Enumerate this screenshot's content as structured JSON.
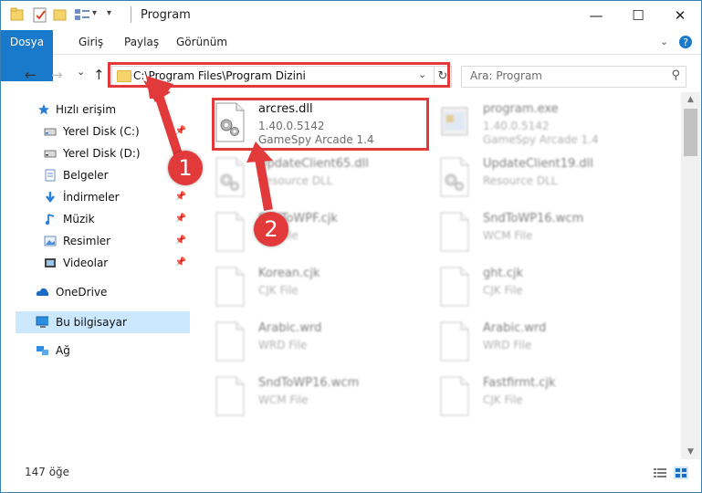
{
  "window": {
    "title": "Program",
    "controls": {
      "minimize": "—",
      "maximize": "☐",
      "close": "✕"
    }
  },
  "ribbon": {
    "tabs": [
      "Dosya",
      "Giriş",
      "Paylaş",
      "Görünüm"
    ],
    "expand_icon": "chevron-down-icon",
    "help_icon": "help-icon"
  },
  "nav": {
    "back": "←",
    "forward": "→",
    "recent": "⌄",
    "up": "↑",
    "address": "C:\\Program Files\\Program Dizini",
    "refresh": "↻",
    "dropdown": "⌄",
    "search_placeholder": "Ara: Program"
  },
  "sidebar": {
    "items": [
      {
        "label": "Hızlı erişim",
        "icon": "star-icon",
        "pinned": false
      },
      {
        "label": "Yerel Disk (C:)",
        "icon": "drive-icon",
        "pinned": true
      },
      {
        "label": "Yerel Disk (D:)",
        "icon": "drive-icon",
        "pinned": false
      },
      {
        "label": "Belgeler",
        "icon": "documents-icon",
        "pinned": true
      },
      {
        "label": "İndirmeler",
        "icon": "download-icon",
        "pinned": true
      },
      {
        "label": "Müzik",
        "icon": "music-icon",
        "pinned": true
      },
      {
        "label": "Resimler",
        "icon": "pictures-icon",
        "pinned": true
      },
      {
        "label": "Videolar",
        "icon": "video-icon",
        "pinned": true
      },
      {
        "label": "OneDrive",
        "icon": "cloud-icon",
        "pinned": false
      },
      {
        "label": "Bu bilgisayar",
        "icon": "computer-icon",
        "pinned": false
      },
      {
        "label": "Ağ",
        "icon": "network-icon",
        "pinned": false
      }
    ],
    "pin_glyph": "📌"
  },
  "files": [
    {
      "name": "arcres.dll",
      "line2": "1.40.0.5142",
      "line3": "GameSpy Arcade 1.4",
      "icon": "dll-gear-icon",
      "highlighted": true
    },
    {
      "name": "program.exe",
      "line2": "1.40.0.5142",
      "line3": "GameSpy Arcade 1.4",
      "icon": "exe-icon",
      "highlighted": false
    },
    {
      "name": "UpdateClient65.dll",
      "line2": "Resource DLL",
      "line3": "",
      "icon": "dll-gear-icon",
      "highlighted": false
    },
    {
      "name": "UpdateClient19.dll",
      "line2": "Resource DLL",
      "line3": "",
      "icon": "dll-gear-icon",
      "highlighted": false
    },
    {
      "name": "SndToWPF.cjk",
      "line2": "CJK File",
      "line3": "",
      "icon": "blank-file-icon",
      "highlighted": false
    },
    {
      "name": "SndToWP16.wcm",
      "line2": "WCM File",
      "line3": "",
      "icon": "blank-file-icon",
      "highlighted": false
    },
    {
      "name": "Korean.cjk",
      "line2": "CJK File",
      "line3": "",
      "icon": "blank-file-icon",
      "highlighted": false
    },
    {
      "name": "ght.cjk",
      "line2": "CJK File",
      "line3": "",
      "icon": "blank-file-icon",
      "highlighted": false
    },
    {
      "name": "Arabic.wrd",
      "line2": "WRD File",
      "line3": "",
      "icon": "blank-file-icon",
      "highlighted": false
    },
    {
      "name": "Arabic.wrd",
      "line2": "WRD File",
      "line3": "",
      "icon": "blank-file-icon",
      "highlighted": false
    },
    {
      "name": "SndToWP16.wcm",
      "line2": "WCM File",
      "line3": "",
      "icon": "blank-file-icon",
      "highlighted": false
    },
    {
      "name": "Fastfirmt.cjk",
      "line2": "CJK File",
      "line3": "",
      "icon": "blank-file-icon",
      "highlighted": false
    }
  ],
  "status": {
    "item_count": "147 öğe"
  },
  "markers": {
    "one": "1",
    "two": "2"
  },
  "colors": {
    "accent": "#1979ca",
    "highlight": "#e23a3a",
    "selected_bg": "#cce8ff"
  }
}
